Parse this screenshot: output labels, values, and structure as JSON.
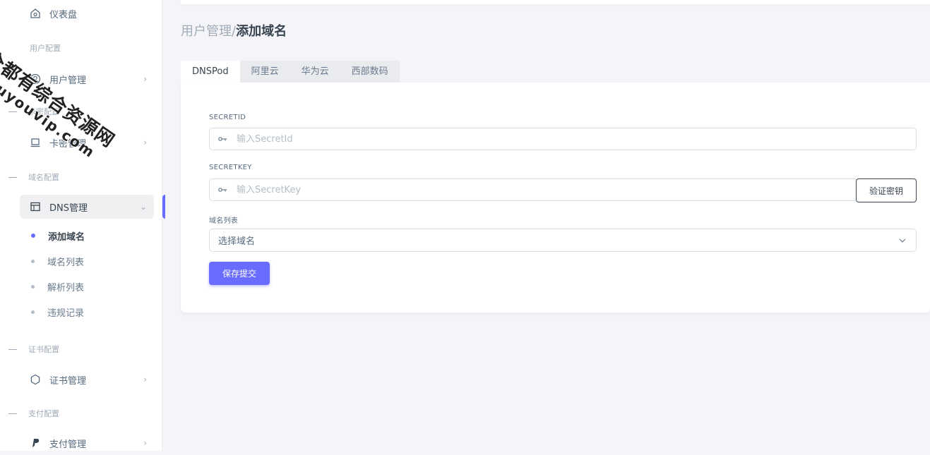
{
  "sidebar": {
    "dashboard": "仪表盘",
    "sections": {
      "user": "用户配置",
      "card": "卡密配置",
      "domain": "域名配置",
      "cert": "证书配置",
      "pay": "支付配置"
    },
    "items": {
      "user_mgmt": "用户管理",
      "card_mgmt": "卡密管理",
      "dns_mgmt": "DNS管理",
      "cert_mgmt": "证书管理",
      "pay_mgmt": "支付管理"
    },
    "dns_sub": [
      "添加域名",
      "域名列表",
      "解析列表",
      "违规记录"
    ]
  },
  "breadcrumb": {
    "parent": "用户管理/",
    "current": "添加域名"
  },
  "tabs": [
    "DNSPod",
    "阿里云",
    "华为云",
    "西部数码"
  ],
  "form": {
    "secret_id_label": "SECRETID",
    "secret_id_placeholder": "输入SecretId",
    "secret_key_label": "SECRETKEY",
    "secret_key_placeholder": "输入SecretKey",
    "verify_button": "验证密钥",
    "domain_list_label": "域名列表",
    "domain_select_value": "选择域名",
    "submit_button": "保存提交"
  },
  "watermark": {
    "line1": "全都有综合资源网",
    "line2": "douyouvip.com"
  },
  "colors": {
    "accent": "#696cff",
    "heading": "#384551",
    "muted": "#a1acb8"
  }
}
